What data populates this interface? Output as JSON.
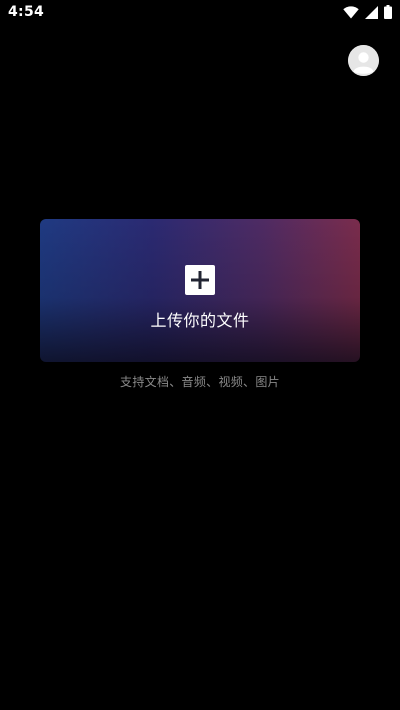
{
  "status_bar": {
    "time": "4:54",
    "icons": [
      "wifi-icon",
      "signal-icon",
      "battery-icon"
    ]
  },
  "header": {
    "avatar_icon": "user-avatar-icon"
  },
  "upload_card": {
    "icon": "plus-icon",
    "label": "上传你的文件"
  },
  "support_text": "支持文档、音频、视频、图片",
  "colors": {
    "background": "#000000",
    "card_gradient_start": "#1f3a82",
    "card_gradient_end": "#7a2c4c",
    "support_text": "#8a8a8a"
  }
}
